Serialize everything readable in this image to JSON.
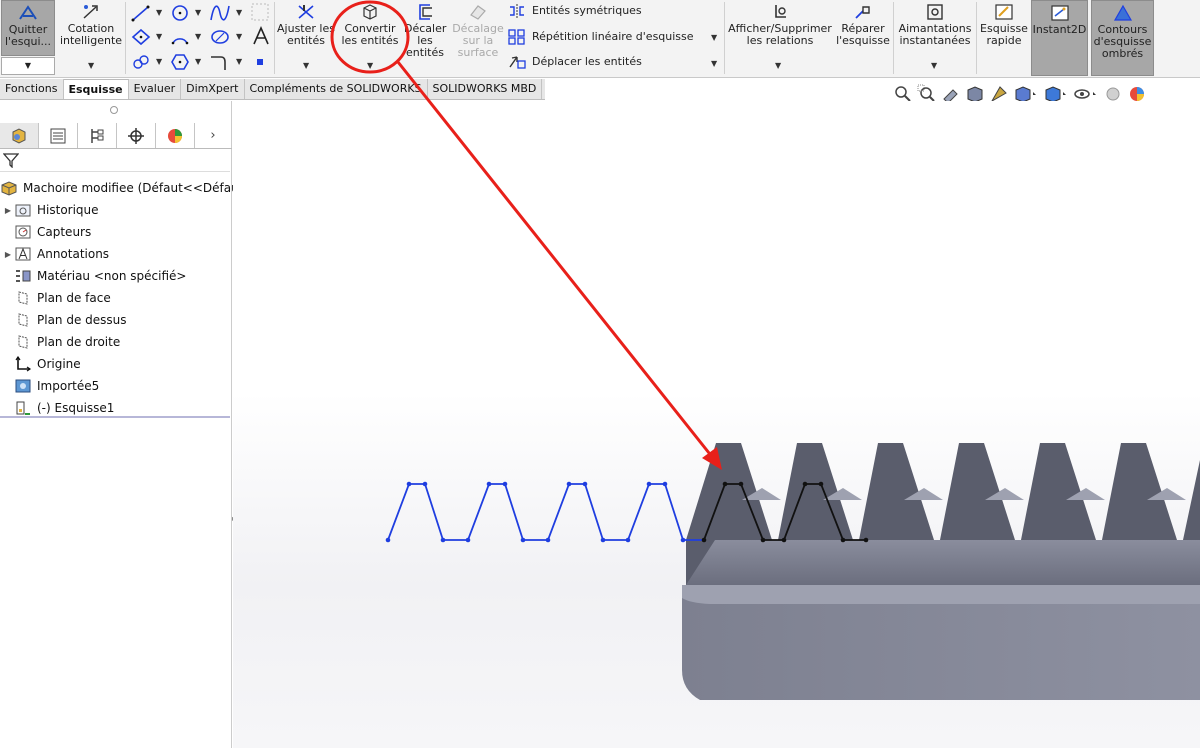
{
  "ribbon": {
    "quit_sketch": {
      "label_line1": "Quitter",
      "label_line2": "l'esqui..."
    },
    "smart_dimension": {
      "label_line1": "Cotation",
      "label_line2": "intelligente"
    },
    "trim_entities": {
      "label_line1": "Ajuster les",
      "label_line2": "entités"
    },
    "convert_entities": {
      "label_line1": "Convertir",
      "label_line2": "les entités"
    },
    "offset_entities": {
      "label_line1": "Décaler",
      "label_line2": "les",
      "label_line3": "entités"
    },
    "offset_surface": {
      "label_line1": "Décalage",
      "label_line2": "sur la",
      "label_line3": "surface"
    },
    "mirror_entities": "Entités symétriques",
    "linear_pattern": "Répétition linéaire d'esquisse",
    "move_entities": "Déplacer les entités",
    "display_relations": {
      "label_line1": "Afficher/Supprimer",
      "label_line2": "les relations"
    },
    "repair_sketch": {
      "label_line1": "Réparer",
      "label_line2": "l'esquisse"
    },
    "quick_snaps": {
      "label_line1": "Aimantations",
      "label_line2": "instantanées"
    },
    "rapid_sketch": {
      "label_line1": "Esquisse",
      "label_line2": "rapide"
    },
    "instant2d": "Instant2D",
    "shaded_contours": {
      "label_line1": "Contours",
      "label_line2": "d'esquisse",
      "label_line3": "ombrés"
    }
  },
  "tabs": [
    "Fonctions",
    "Esquisse",
    "Evaluer",
    "DimXpert",
    "Compléments de SOLIDWORKS",
    "SOLIDWORKS MBD"
  ],
  "active_tab": "Esquisse",
  "tree": {
    "root": "Machoire modifiee  (Défaut<<Défaut>_",
    "items": [
      "Historique",
      "Capteurs",
      "Annotations",
      "Matériau <non spécifié>",
      "Plan de face",
      "Plan de dessus",
      "Plan de droite",
      "Origine",
      "Importée5",
      "(-) Esquisse1"
    ]
  },
  "colors": {
    "accent_blue": "#1f3ee0",
    "annotation_red": "#e8201a",
    "model_gray": "#7b7e8e"
  }
}
